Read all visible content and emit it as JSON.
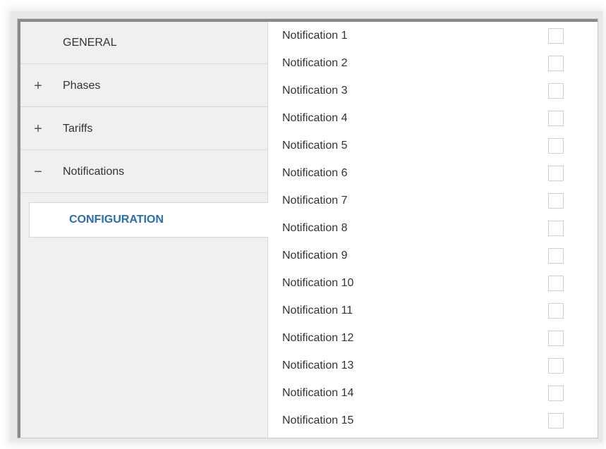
{
  "sidebar": {
    "items": [
      {
        "label": "GENERAL",
        "toggle": ""
      },
      {
        "label": "Phases",
        "toggle": "+"
      },
      {
        "label": "Tariffs",
        "toggle": "+"
      },
      {
        "label": "Notifications",
        "toggle": "−"
      }
    ],
    "sub_item": {
      "label": "CONFIGURATION"
    }
  },
  "notifications": [
    {
      "label": "Notification 1",
      "checked": false
    },
    {
      "label": "Notification 2",
      "checked": false
    },
    {
      "label": "Notification 3",
      "checked": false
    },
    {
      "label": "Notification 4",
      "checked": false
    },
    {
      "label": "Notification 5",
      "checked": false
    },
    {
      "label": "Notification 6",
      "checked": false
    },
    {
      "label": "Notification 7",
      "checked": false
    },
    {
      "label": "Notification 8",
      "checked": false
    },
    {
      "label": "Notification 9",
      "checked": false
    },
    {
      "label": "Notification 10",
      "checked": false
    },
    {
      "label": "Notification 11",
      "checked": false
    },
    {
      "label": "Notification 12",
      "checked": false
    },
    {
      "label": "Notification 13",
      "checked": false
    },
    {
      "label": "Notification 14",
      "checked": false
    },
    {
      "label": "Notification 15",
      "checked": false
    }
  ],
  "colors": {
    "accent": "#2b6cb0",
    "sidebar_bg": "#f0f0f0"
  }
}
